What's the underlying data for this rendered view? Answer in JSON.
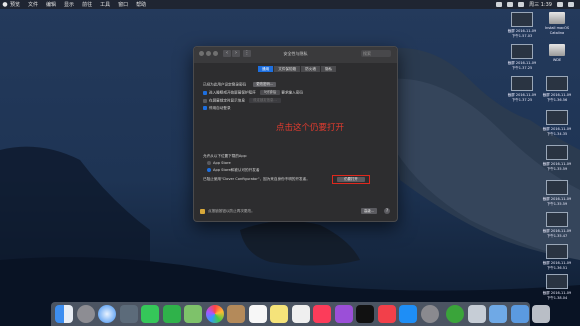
{
  "menubar": {
    "items": [
      "预览",
      "文件",
      "编辑",
      "显示",
      "前往",
      "工具",
      "窗口",
      "帮助"
    ],
    "clock": "周三 1:39"
  },
  "desktop": {
    "right_icons": [
      {
        "label1": "截屏 2016-11-09",
        "label2": "下午1.57.03",
        "kind": "screenshot"
      },
      {
        "label1": "Install macOS",
        "label2": "Catalina",
        "kind": "drive"
      },
      {
        "label1": "截屏 2016-11-09",
        "label2": "下午1.37.25",
        "kind": "screenshot"
      },
      {
        "label1": "WDE",
        "label2": "",
        "kind": "drive"
      },
      {
        "label1": "截屏 2016-11-09",
        "label2": "下午1.37.25",
        "kind": "screenshot"
      },
      {
        "label1": "截屏 2016-11-09",
        "label2": "下午1.36.56",
        "kind": "screenshot"
      },
      {
        "label1": "截屏 2016-11-09",
        "label2": "下午1.34.35",
        "kind": "screenshot"
      },
      {
        "label1": "截屏 2016-11-09",
        "label2": "下午1.35.59",
        "kind": "screenshot"
      },
      {
        "label1": "截屏 2016-11-09",
        "label2": "下午1.35.59",
        "kind": "screenshot"
      },
      {
        "label1": "截屏 2016-11-09",
        "label2": "下午1.35.47",
        "kind": "screenshot"
      },
      {
        "label1": "截屏 2016-11-09",
        "label2": "下午1.36.51",
        "kind": "screenshot"
      },
      {
        "label1": "截屏 2016-11-09",
        "label2": "下午1.38.04",
        "kind": "screenshot"
      }
    ]
  },
  "window": {
    "title": "安全性与隐私",
    "search_placeholder": "搜索",
    "tabs": [
      {
        "label": "通用",
        "selected": true
      },
      {
        "label": "文件保险箱",
        "selected": false
      },
      {
        "label": "防火墙",
        "selected": false
      },
      {
        "label": "隐私",
        "selected": false
      }
    ],
    "general": {
      "password_line": "已经为此用户设定登录密码",
      "change_password": "更改密码...",
      "require_prefix": "进入睡眠或开始屏幕保护程序",
      "require_value": "5分钟后",
      "require_suffix": "要求输入密码",
      "show_message": "在屏幕锁定时显示信息",
      "set_lock_message": "设定锁定信息...",
      "disable_auto_login": "停用自动登录"
    },
    "allow_apps": {
      "heading": "允许从以下位置下载的App:",
      "option1": "App Store",
      "option2": "App Store和被认可的开发者",
      "blocked_msg": "已阻止使用\"Clover Configurator\"，因为来自身份不明的开发者。",
      "open_anyway": "仍要打开"
    },
    "lock_text": "点按锁按钮以防止再次更改。",
    "advanced": "高级...",
    "help": "?"
  },
  "annotation": {
    "text": "点击这个仍要打开",
    "color": "#e33b2f"
  },
  "dock": {
    "apps": [
      "finder-icon",
      "launchpad-icon",
      "safari-icon",
      "photos-browser-icon",
      "messages-icon",
      "facetime-icon",
      "maps-icon",
      "photos-icon",
      "contacts-icon",
      "calendar-icon",
      "notes-icon",
      "reminders-icon",
      "music-icon",
      "podcasts-icon",
      "apple-tv-icon",
      "news-icon",
      "app-store-icon",
      "system-preferences-icon",
      "terminal-icon",
      "preview-icon",
      "folder-icon",
      "downloads-icon",
      "trash-icon"
    ]
  },
  "colors": {
    "accent": "#1d6fe0",
    "highlight_border": "#e0281d"
  }
}
